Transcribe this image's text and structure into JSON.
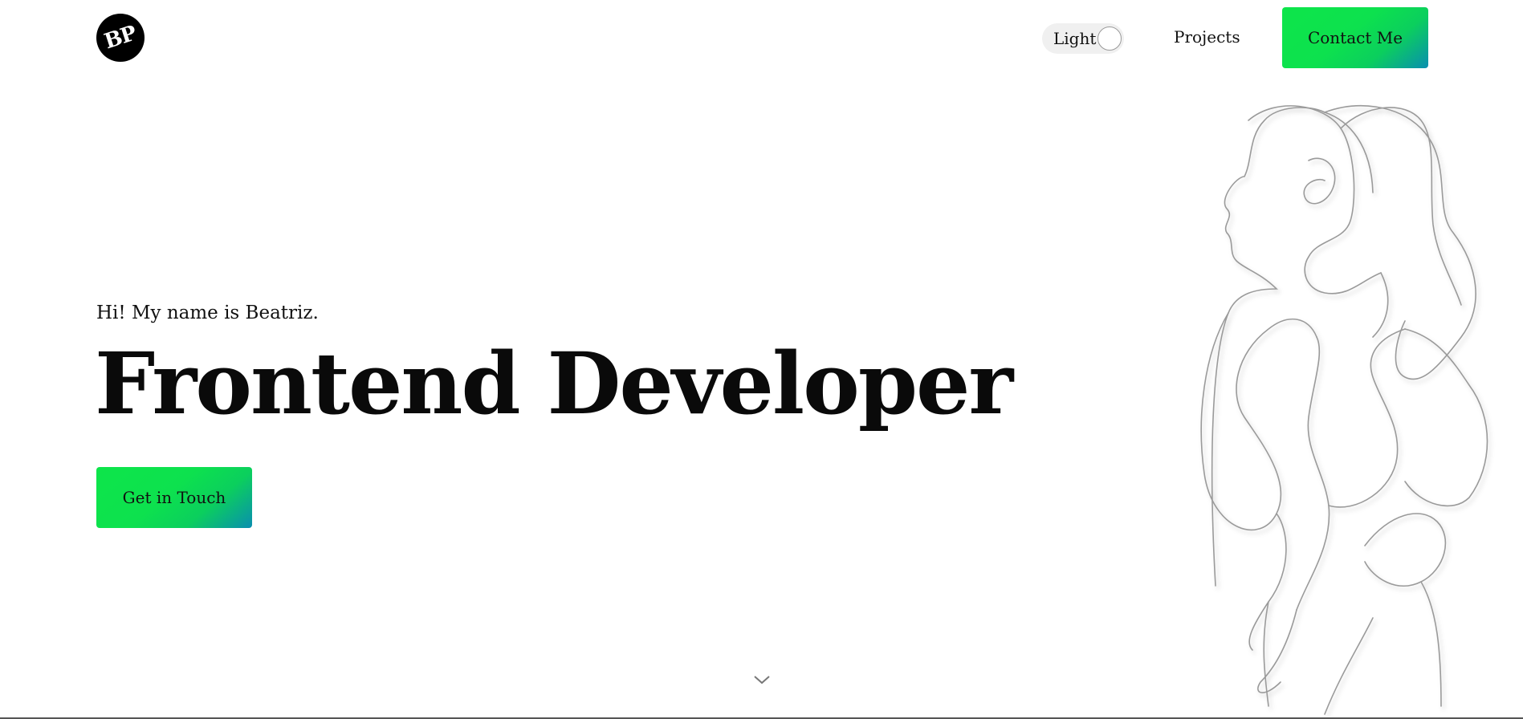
{
  "header": {
    "logo_text": "BP",
    "theme_toggle_label": "Light",
    "nav_projects_label": "Projects",
    "contact_button_label": "Contact Me"
  },
  "hero": {
    "intro": "Hi! My name is Beatriz.",
    "headline": "Frontend Developer",
    "cta_label": "Get in Touch"
  },
  "icons": {
    "scroll_down": "chevron-down-icon",
    "illustration": "line-art-woman-profile"
  },
  "colors": {
    "background": "#ffffff",
    "text": "#111111",
    "accent_green": "#0de54a",
    "accent_teal": "#0a8eb0",
    "logo_bg": "#000000",
    "line_art": "#9a9a9a"
  }
}
